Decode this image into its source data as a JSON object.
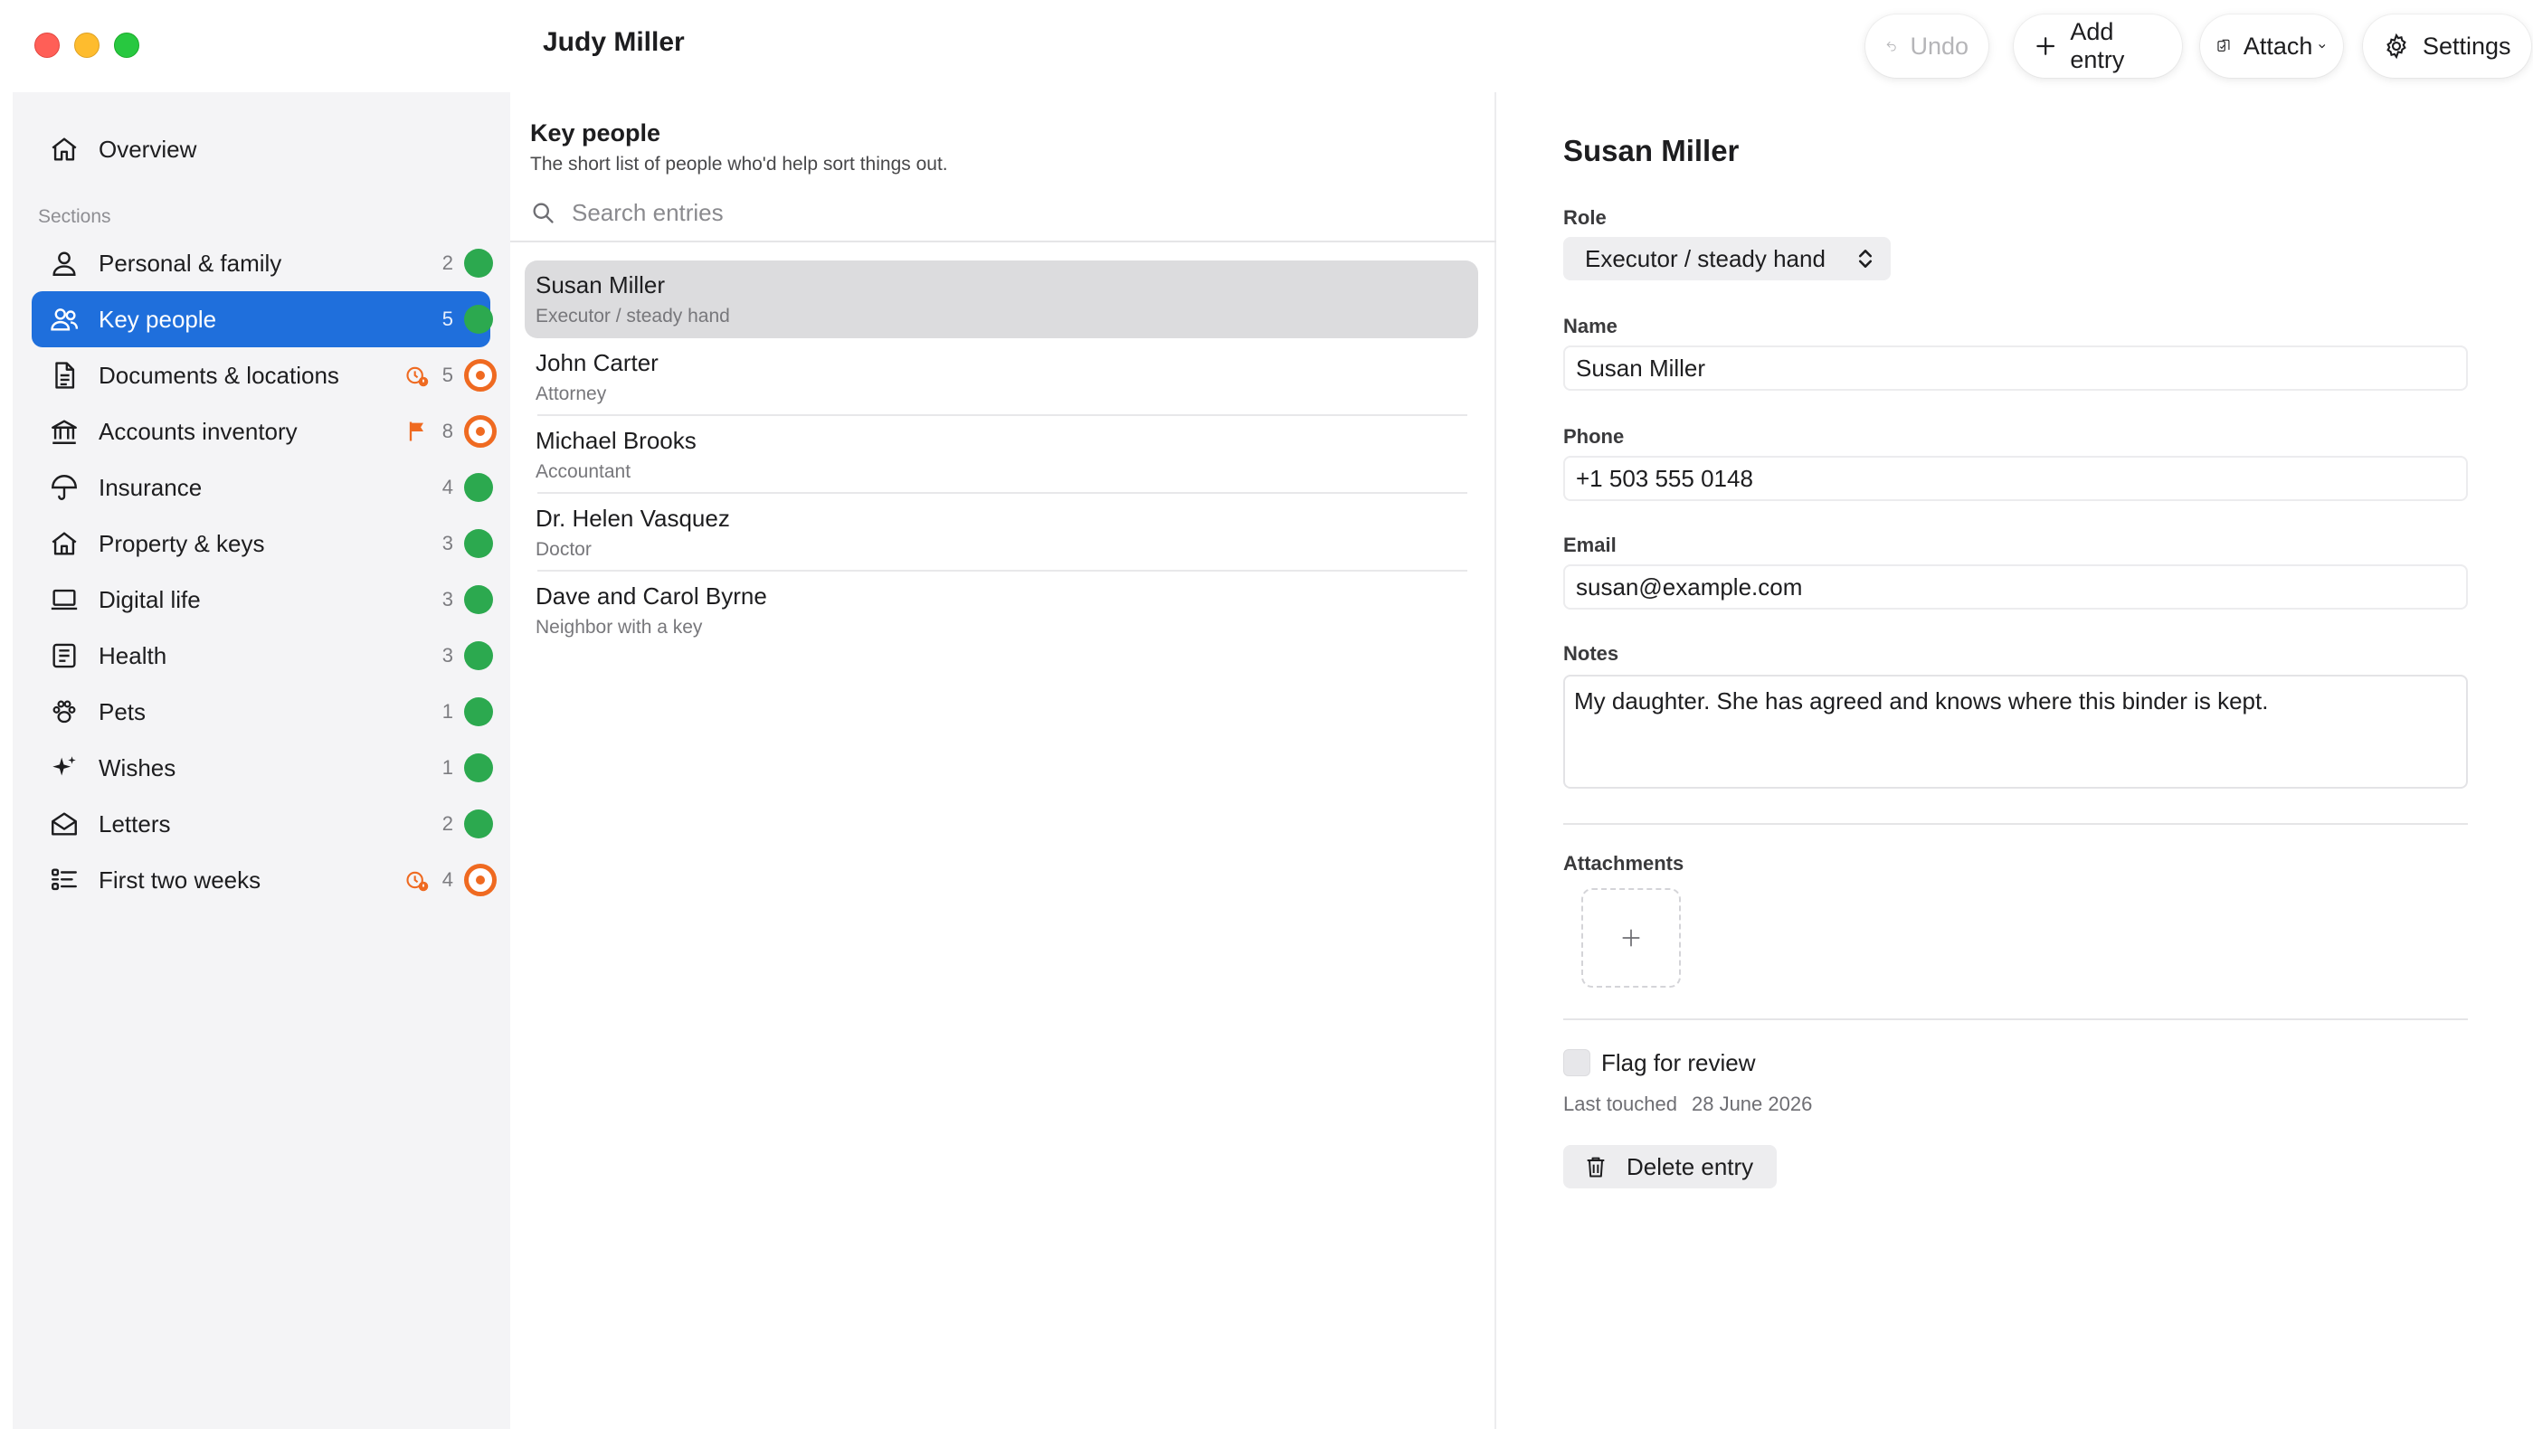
{
  "window": {
    "title": "Judy Miller"
  },
  "toolbar": {
    "undo_label": "Undo",
    "add_label": "Add entry",
    "attach_label": "Attach",
    "settings_label": "Settings"
  },
  "sidebar": {
    "overview_label": "Overview",
    "sections_label": "Sections",
    "items": [
      {
        "label": "Personal & family",
        "count": "2",
        "status": "ok",
        "icon": "person-icon"
      },
      {
        "label": "Key people",
        "count": "5",
        "status": "ok",
        "icon": "people-icon",
        "active": true
      },
      {
        "label": "Documents & locations",
        "count": "5",
        "status": "attention",
        "icon": "document-icon",
        "marker": "clock-warning-icon"
      },
      {
        "label": "Accounts inventory",
        "count": "8",
        "status": "attention",
        "icon": "bank-icon",
        "marker": "flag-icon"
      },
      {
        "label": "Insurance",
        "count": "4",
        "status": "ok",
        "icon": "umbrella-icon"
      },
      {
        "label": "Property & keys",
        "count": "3",
        "status": "ok",
        "icon": "house-icon"
      },
      {
        "label": "Digital life",
        "count": "3",
        "status": "ok",
        "icon": "laptop-icon"
      },
      {
        "label": "Health",
        "count": "3",
        "status": "ok",
        "icon": "clipboard-icon"
      },
      {
        "label": "Pets",
        "count": "1",
        "status": "ok",
        "icon": "paw-icon"
      },
      {
        "label": "Wishes",
        "count": "1",
        "status": "ok",
        "icon": "sparkle-icon"
      },
      {
        "label": "Letters",
        "count": "2",
        "status": "ok",
        "icon": "envelope-icon"
      },
      {
        "label": "First two weeks",
        "count": "4",
        "status": "attention",
        "icon": "checklist-icon",
        "marker": "clock-warning-icon"
      }
    ],
    "colors": {
      "active": "#1f6fdc",
      "ok": "#2ca94f",
      "attention": "#ef6a21"
    }
  },
  "list": {
    "title": "Key people",
    "subtitle": "The short list of people who'd help sort things out.",
    "search_placeholder": "Search entries",
    "entries": [
      {
        "name": "Susan Miller",
        "role": "Executor / steady hand",
        "selected": true
      },
      {
        "name": "John Carter",
        "role": "Attorney"
      },
      {
        "name": "Michael Brooks",
        "role": "Accountant"
      },
      {
        "name": "Dr. Helen Vasquez",
        "role": "Doctor"
      },
      {
        "name": "Dave and Carol Byrne",
        "role": "Neighbor with a key"
      }
    ]
  },
  "detail": {
    "title": "Susan Miller",
    "role_label": "Role",
    "role_value": "Executor / steady hand",
    "name_label": "Name",
    "name_value": "Susan Miller",
    "phone_label": "Phone",
    "phone_value": "+1 503 555 0148",
    "email_label": "Email",
    "email_value": "susan@example.com",
    "notes_label": "Notes",
    "notes_value": "My daughter. She has agreed and knows where this binder is kept.",
    "attachments_label": "Attachments",
    "flag_label": "Flag for review",
    "last_touched_label": "Last touched",
    "last_touched_value": "28 June 2026",
    "delete_label": "Delete entry"
  }
}
